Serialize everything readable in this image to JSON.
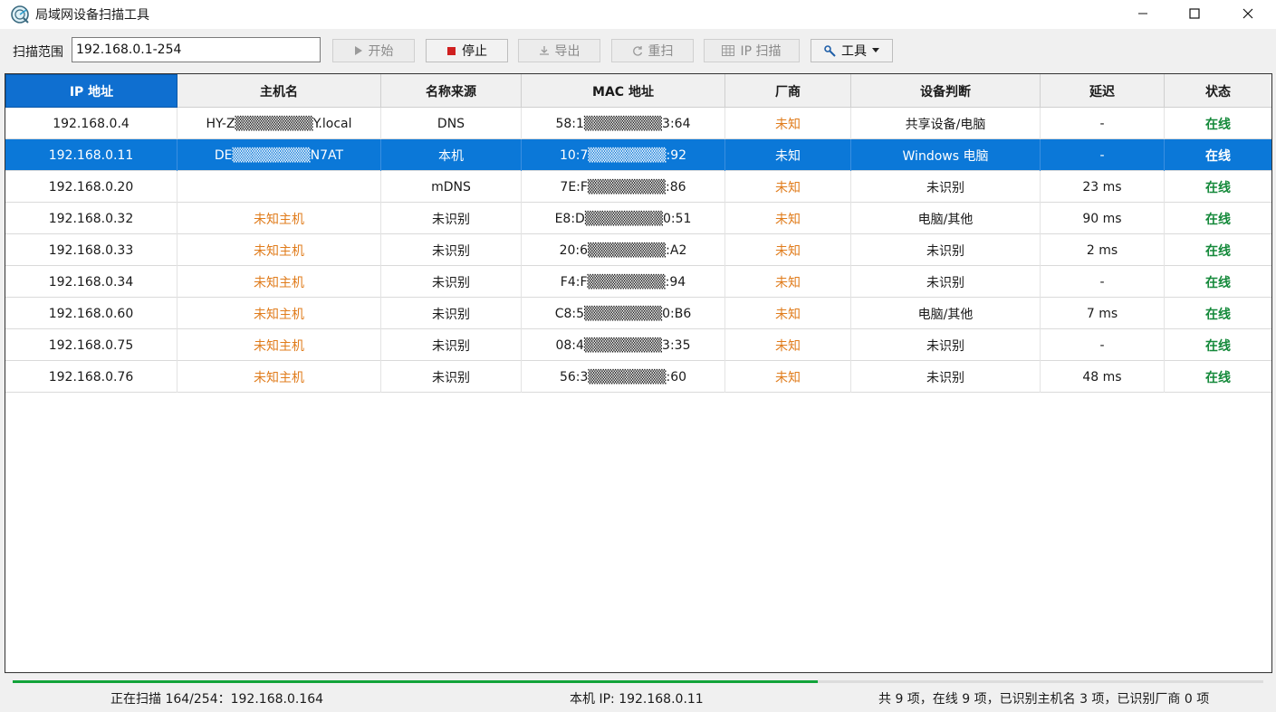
{
  "window": {
    "title": "局域网设备扫描工具"
  },
  "toolbar": {
    "range_label": "扫描范围",
    "range_value": "192.168.0.1-254",
    "start_label": "开始",
    "stop_label": "停止",
    "export_label": "导出",
    "rescan_label": "重扫",
    "ipscan_label": "IP 扫描",
    "tools_label": "工具"
  },
  "table": {
    "columns": [
      "IP 地址",
      "主机名",
      "名称来源",
      "MAC 地址",
      "厂商",
      "设备判断",
      "延迟",
      "状态"
    ],
    "rows": [
      [
        "192.168.0.4",
        "HY-Z▒▒▒▒▒▒▒▒Y.local",
        "DNS",
        "58:1▒▒▒▒▒▒▒▒3:64",
        "未知",
        "共享设备/电脑",
        "-",
        "在线"
      ],
      [
        "192.168.0.11",
        "DE▒▒▒▒▒▒▒▒N7AT",
        "本机",
        "10:7▒▒▒▒▒▒▒▒:92",
        "未知",
        "Windows 电脑",
        "-",
        "在线"
      ],
      [
        "192.168.0.20",
        "",
        "mDNS",
        "7E:F▒▒▒▒▒▒▒▒:86",
        "未知",
        "未识别",
        "23 ms",
        "在线"
      ],
      [
        "192.168.0.32",
        "未知主机",
        "未识别",
        "E8:D▒▒▒▒▒▒▒▒0:51",
        "未知",
        "电脑/其他",
        "90 ms",
        "在线"
      ],
      [
        "192.168.0.33",
        "未知主机",
        "未识别",
        "20:6▒▒▒▒▒▒▒▒:A2",
        "未知",
        "未识别",
        "2 ms",
        "在线"
      ],
      [
        "192.168.0.34",
        "未知主机",
        "未识别",
        "F4:F▒▒▒▒▒▒▒▒:94",
        "未知",
        "未识别",
        "-",
        "在线"
      ],
      [
        "192.168.0.60",
        "未知主机",
        "未识别",
        "C8:5▒▒▒▒▒▒▒▒0:B6",
        "未知",
        "电脑/其他",
        "7 ms",
        "在线"
      ],
      [
        "192.168.0.75",
        "未知主机",
        "未识别",
        "08:4▒▒▒▒▒▒▒▒3:35",
        "未知",
        "未识别",
        "-",
        "在线"
      ],
      [
        "192.168.0.76",
        "未知主机",
        "未识别",
        "56:3▒▒▒▒▒▒▒▒:60",
        "未知",
        "未识别",
        "48 ms",
        "在线"
      ]
    ],
    "selected_row_index": 1
  },
  "progress": {
    "fraction": 0.644
  },
  "statusbar": {
    "scan_progress": "正在扫描 164/254：192.168.0.164",
    "local_ip": "本机 IP: 192.168.0.11",
    "summary": "共 9 项，在线 9 项，已识别主机名 3 项，已识别厂商 0 项"
  },
  "colors": {
    "accent": "#0b78d8",
    "unknown_orange": "#e07c1c",
    "online_green": "#14893a"
  },
  "icons": [
    "app-radar-icon",
    "play-icon",
    "stop-icon",
    "export-icon",
    "refresh-icon",
    "grid-icon",
    "wrench-icon",
    "dropdown-arrow-icon"
  ]
}
